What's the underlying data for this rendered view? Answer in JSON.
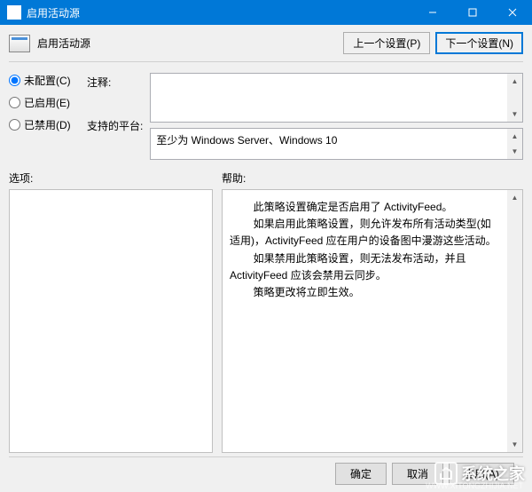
{
  "titlebar": {
    "title": "启用活动源"
  },
  "header": {
    "title": "启用活动源",
    "prev_btn": "上一个设置(P)",
    "next_btn": "下一个设置(N)"
  },
  "radios": {
    "not_configured": "未配置(C)",
    "enabled": "已启用(E)",
    "disabled": "已禁用(D)"
  },
  "labels": {
    "comment": "注释:",
    "platform": "支持的平台:",
    "options": "选项:",
    "help": "帮助:"
  },
  "platform_text": "至少为 Windows Server、Windows 10",
  "help_text": "        此策略设置确定是否启用了 ActivityFeed。\n        如果启用此策略设置，则允许发布所有活动类型(如适用)，ActivityFeed 应在用户的设备图中漫游这些活动。\n        如果禁用此策略设置，则无法发布活动，并且 ActivityFeed 应该会禁用云同步。\n        策略更改将立即生效。",
  "buttons": {
    "ok": "确定",
    "cancel": "取消",
    "apply": "应用(A)"
  },
  "watermark": {
    "text": "系统之家",
    "url": "WWW.XITONGZHIJIA.NET"
  }
}
